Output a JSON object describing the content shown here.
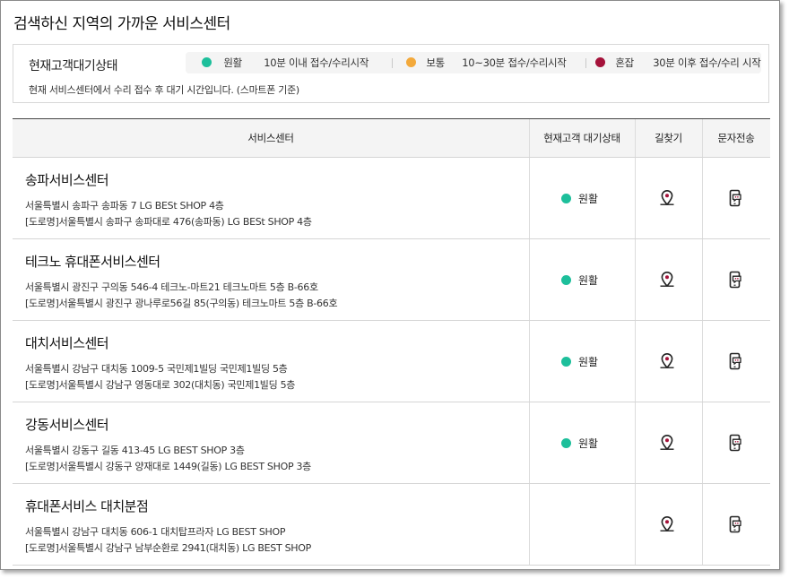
{
  "page": {
    "title": "검색하신 지역의 가까운 서비스센터"
  },
  "legend": {
    "title": "현재고객대기상태",
    "items": [
      {
        "status": "원활",
        "desc": "10분 이내 접수/수리시작",
        "color": "#1dbf9b"
      },
      {
        "status": "보통",
        "desc": "10~30분 접수/수리시작",
        "color": "#f3a93b"
      },
      {
        "status": "혼잡",
        "desc": "30분 이후 접수/수리 시작",
        "color": "#a5123a"
      }
    ],
    "note": "현재 서비스센터에서 수리 접수 후 대기 시간입니다. (스마트폰 기준)"
  },
  "table": {
    "headers": {
      "center": "서비스센터",
      "status": "현재고객 대기상태",
      "directions": "길찾기",
      "sms": "문자전송"
    },
    "rows": [
      {
        "name": "송파서비스센터",
        "addr1": "서울특별시 송파구 송파동 7 LG BESt SHOP 4층",
        "addr2": "[도로명]서울특별시 송파구 송파대로 476(송파동) LG BESt SHOP 4층",
        "status": "원활"
      },
      {
        "name": "테크노 휴대폰서비스센터",
        "addr1": "서울특별시 광진구 구의동 546-4 테크노-마트21 테크노마트 5층 B-66호",
        "addr2": "[도로명]서울특별시 광진구 광나루로56길 85(구의동) 테크노마트 5층 B-66호",
        "status": "원활"
      },
      {
        "name": "대치서비스센터",
        "addr1": "서울특별시 강남구 대치동 1009-5 국민제1빌딩 국민제1빌딩 5층",
        "addr2": "[도로명]서울특별시 강남구 영동대로 302(대치동) 국민제1빌딩 5층",
        "status": "원활"
      },
      {
        "name": "강동서비스센터",
        "addr1": "서울특별시 강동구 길동 413-45 LG BEST SHOP 3층",
        "addr2": "[도로명]서울특별시 강동구 양재대로 1449(길동) LG BEST SHOP 3층",
        "status": "원활"
      },
      {
        "name": "휴대폰서비스 대치분점",
        "addr1": "서울특별시 강남구 대치동 606-1 대치탑프라자 LG BEST SHOP",
        "addr2": "[도로명]서울특별시 강남구 남부순환로 2941(대치동) LG BEST SHOP",
        "status": ""
      }
    ]
  },
  "icons": {
    "status": "status-dot-icon",
    "directions": "map-pin-icon",
    "sms": "phone-message-icon"
  }
}
